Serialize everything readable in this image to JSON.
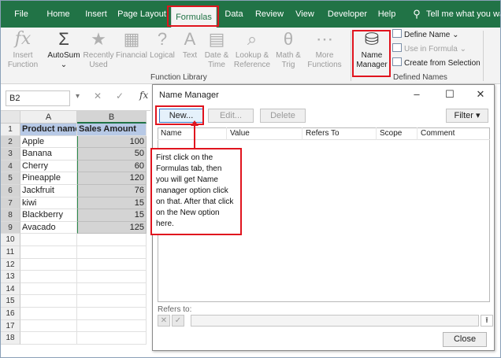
{
  "ribbon_tabs": [
    "File",
    "Home",
    "Insert",
    "Page Layout",
    "Formulas",
    "Data",
    "Review",
    "View",
    "Developer",
    "Help"
  ],
  "active_tab": "Formulas",
  "tell_me": "Tell me what you wa",
  "ribbon": {
    "insert_function": "Insert\nFunction",
    "autosum": "AutoSum",
    "recently_used": "Recently\nUsed",
    "financial": "Financial",
    "logical": "Logical",
    "text": "Text",
    "date_time": "Date &\nTime",
    "lookup_reference": "Lookup &\nReference",
    "math_trig": "Math &\nTrig",
    "more_functions": "More\nFunctions",
    "function_library_label": "Function Library",
    "name_manager": "Name\nManager",
    "define_name": "Define Name",
    "use_in_formula": "Use in Formula",
    "create_from_selection": "Create from Selection",
    "defined_names_label": "Defined Names"
  },
  "formula_bar": {
    "name_box": "B2",
    "fx": "fx"
  },
  "sheet": {
    "columns": [
      "A",
      "B"
    ],
    "header_row": [
      "Product name",
      "Sales Amount"
    ],
    "rows": [
      {
        "product": "Apple",
        "amount": "100"
      },
      {
        "product": "Banana",
        "amount": "50"
      },
      {
        "product": "Cherry",
        "amount": "60"
      },
      {
        "product": "Pineapple",
        "amount": "120"
      },
      {
        "product": "Jackfruit",
        "amount": "76"
      },
      {
        "product": "kiwi",
        "amount": "15"
      },
      {
        "product": "Blackberry",
        "amount": "15"
      },
      {
        "product": "Avacado",
        "amount": "125"
      }
    ],
    "row_numbers": [
      "1",
      "2",
      "3",
      "4",
      "5",
      "6",
      "7",
      "8",
      "9",
      "10",
      "11",
      "12",
      "13",
      "14",
      "15",
      "16",
      "17",
      "18"
    ]
  },
  "dialog": {
    "title": "Name Manager",
    "new_btn": "New...",
    "edit_btn": "Edit...",
    "delete_btn": "Delete",
    "filter_btn": "Filter",
    "columns": [
      "Name",
      "Value",
      "Refers To",
      "Scope",
      "Comment"
    ],
    "refers_to_label": "Refers to:",
    "close_btn": "Close",
    "minimize": "–",
    "maximize": "☐",
    "close_x": "✕"
  },
  "annotation": "First click on the Formulas tab, then you will get Name manager option click on that. After that click on the New option here.",
  "colors": {
    "excel_green": "#217346",
    "highlight_red": "#e0141e",
    "header_blue": "#b7c9e6"
  }
}
